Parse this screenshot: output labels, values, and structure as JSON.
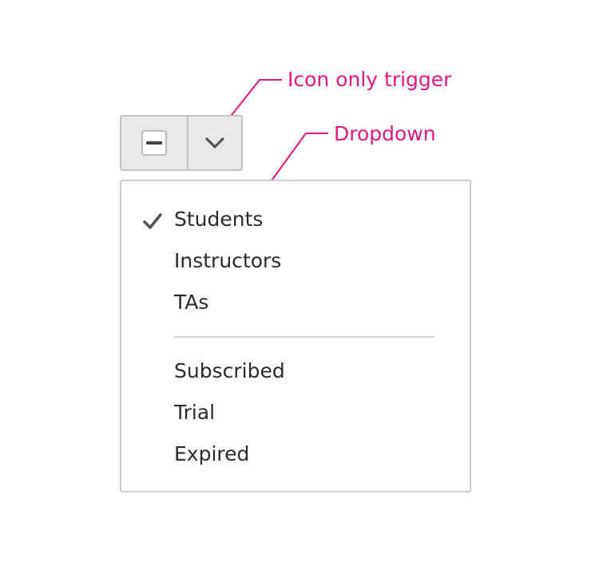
{
  "annotations": {
    "trigger_label": "Icon only trigger",
    "dropdown_label": "Dropdown",
    "color": "#e5177f"
  },
  "trigger": {
    "checkbox_state": "indeterminate",
    "checkbox_icon": "minus-icon",
    "chevron_icon": "chevron-down-icon"
  },
  "menu": {
    "group_1": [
      {
        "label": "Students",
        "selected": true
      },
      {
        "label": "Instructors",
        "selected": false
      },
      {
        "label": "TAs",
        "selected": false
      }
    ],
    "group_2": [
      {
        "label": "Subscribed",
        "selected": false
      },
      {
        "label": "Trial",
        "selected": false
      },
      {
        "label": "Expired",
        "selected": false
      }
    ],
    "check_icon": "checkmark-icon"
  }
}
